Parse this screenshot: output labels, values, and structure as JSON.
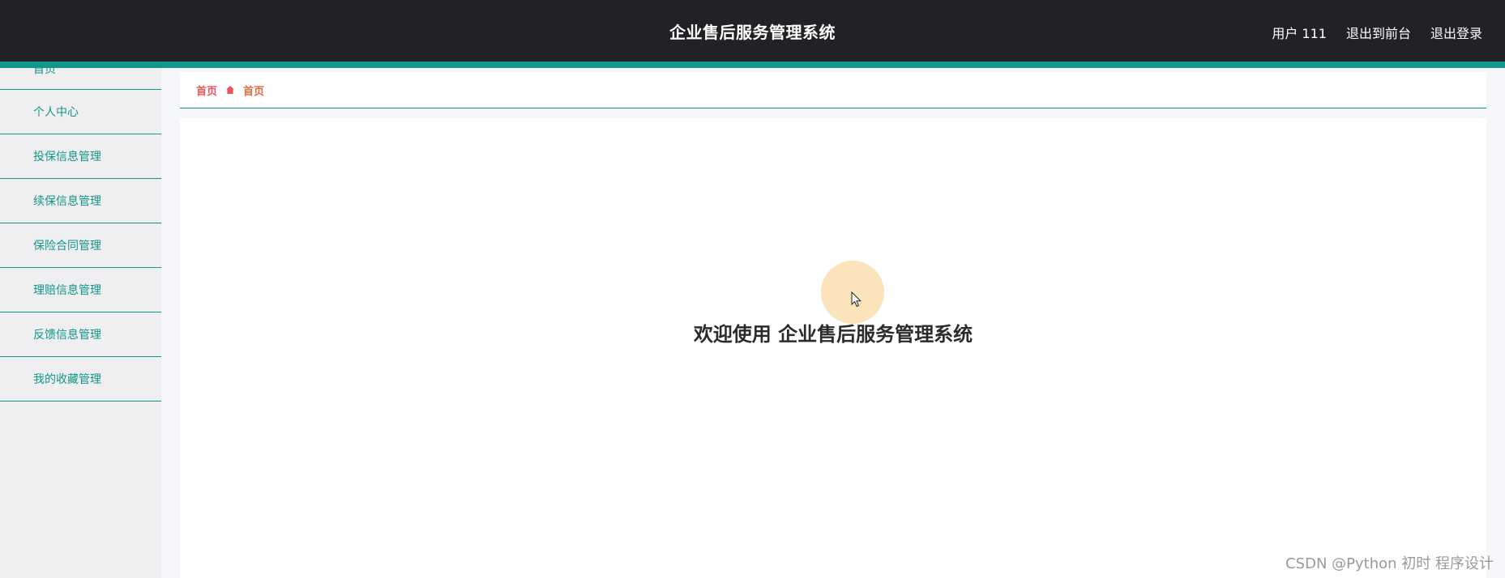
{
  "header": {
    "title": "企业售后服务管理系统",
    "user_label": "用户 111",
    "back_to_front": "退出到前台",
    "logout": "退出登录"
  },
  "sidebar": {
    "items": [
      {
        "label": "首页"
      },
      {
        "label": "个人中心"
      },
      {
        "label": "投保信息管理"
      },
      {
        "label": "续保信息管理"
      },
      {
        "label": "保险合同管理"
      },
      {
        "label": "理赔信息管理"
      },
      {
        "label": "反馈信息管理"
      },
      {
        "label": "我的收藏管理"
      }
    ]
  },
  "breadcrumb": {
    "home": "首页",
    "current": "首页"
  },
  "main": {
    "welcome": "欢迎使用 企业售后服务管理系统"
  },
  "watermark": "CSDN @Python 初时 程序设计",
  "colors": {
    "header_bg": "#222125",
    "accent": "#12968a",
    "sidebar_bg": "#efeff1",
    "crumb_link": "#e8555c"
  },
  "icons": {
    "breadcrumb_separator": "home-icon"
  }
}
